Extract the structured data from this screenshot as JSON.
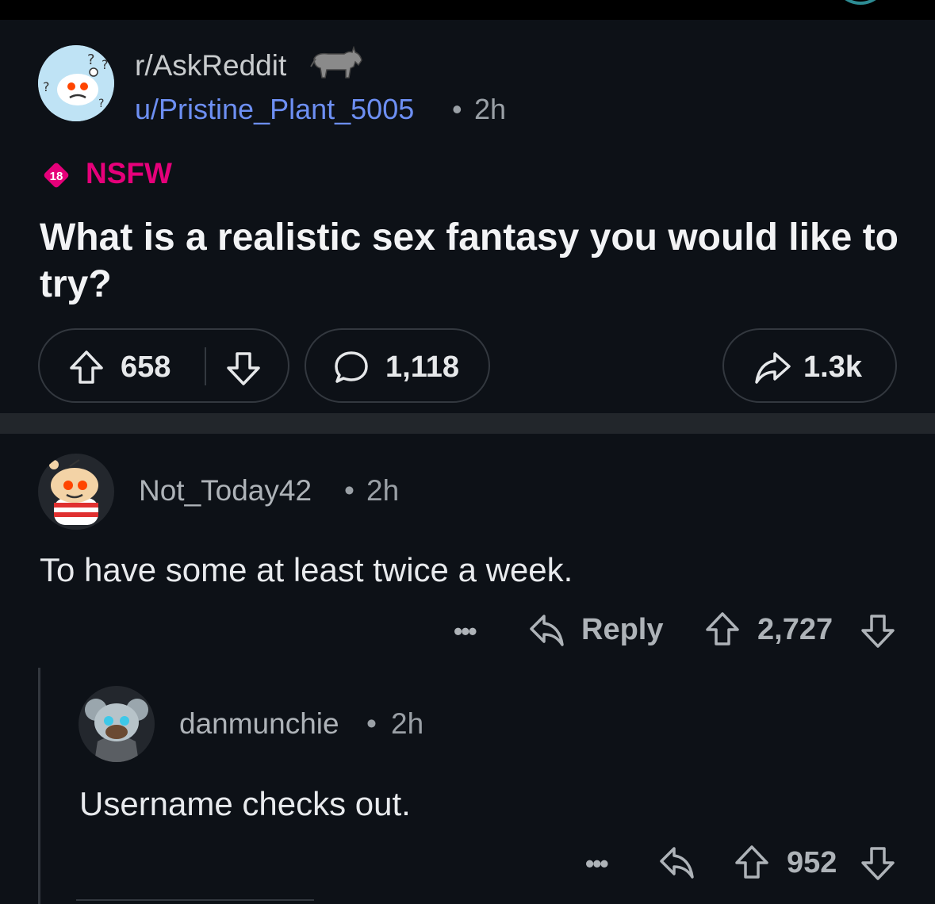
{
  "post": {
    "subreddit": "r/AskReddit",
    "author": "u/Pristine_Plant_5005",
    "separator": "•",
    "time": "2h",
    "nsfw_badge": "18",
    "nsfw_label": "NSFW",
    "title": "What is a realistic sex fantasy you would like to try?",
    "upvotes": "658",
    "comments": "1,118",
    "shares": "1.3k"
  },
  "comments": [
    {
      "author": "Not_Today42",
      "separator": "•",
      "time": "2h",
      "body": "To have some at least twice a week.",
      "more": "•••",
      "reply_label": "Reply",
      "score": "2,727"
    },
    {
      "author": "danmunchie",
      "separator": "•",
      "time": "2h",
      "body": "Username checks out.",
      "more": "•••",
      "score": "952"
    }
  ],
  "icons": {
    "upvote": "arrow-up-outline",
    "downvote": "arrow-down-outline",
    "comment": "speech-bubble",
    "share": "share-arrow",
    "reply": "reply-arrow"
  },
  "colors": {
    "background": "#0d1117",
    "username_link": "#6d8ff3",
    "nsfw": "#e6007a"
  }
}
